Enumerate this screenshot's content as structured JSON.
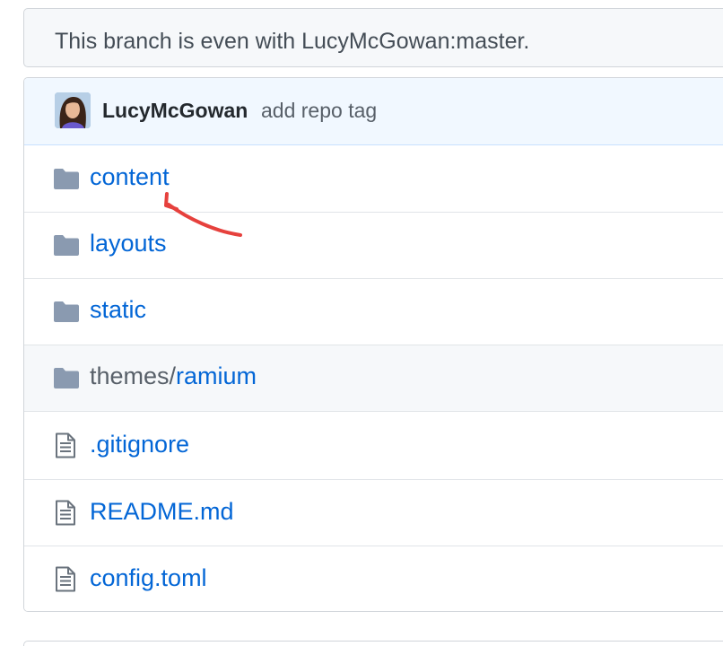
{
  "branch_status": {
    "text": "This branch is even with LucyMcGowan:master."
  },
  "latest_commit": {
    "author": "LucyMcGowan",
    "message": "add repo tag"
  },
  "files": [
    {
      "name": "content",
      "type": "folder"
    },
    {
      "name": "layouts",
      "type": "folder"
    },
    {
      "name": "static",
      "type": "folder"
    },
    {
      "name_prefix": "themes/",
      "name": "ramium",
      "type": "submodule"
    },
    {
      "name": ".gitignore",
      "type": "file"
    },
    {
      "name": "README.md",
      "type": "file"
    },
    {
      "name": "config.toml",
      "type": "file"
    }
  ],
  "icons": {
    "folder": "folder-icon",
    "submodule": "folder-icon",
    "file": "file-text-icon"
  },
  "colors": {
    "link": "#0366d6",
    "folder_icon": "#79b8ff",
    "annotation_arrow": "#e6413d"
  }
}
